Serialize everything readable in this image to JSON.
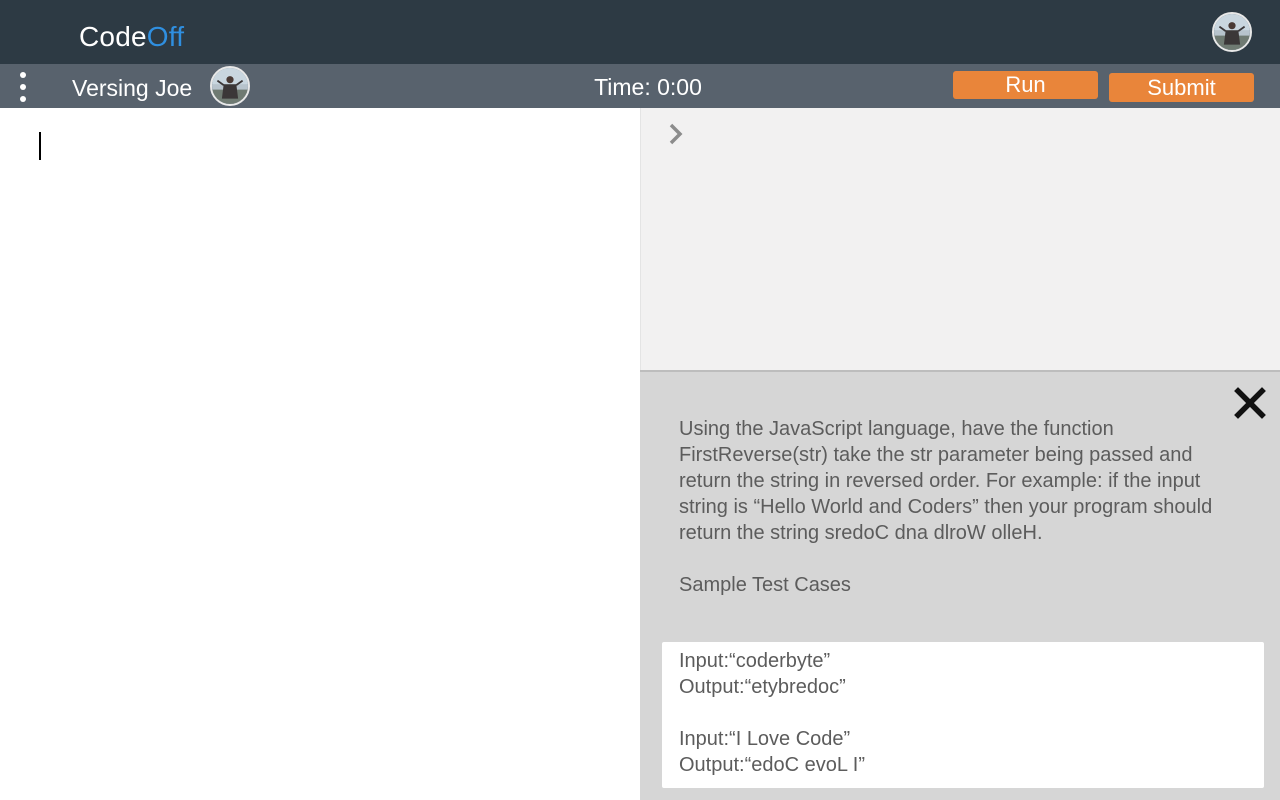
{
  "app": {
    "logo_main": "Code",
    "logo_accent": "Off",
    "accent_color": "#2f8fe0"
  },
  "header": {
    "opponent_name": "Versing Joe",
    "timer": "Time: 0:00",
    "run_label": "Run",
    "submit_label": "Submit",
    "button_color": "#e9853a"
  },
  "icons": {
    "menu": "vertical-dots-icon",
    "console_prompt": "chevron-right-icon",
    "close": "close-icon"
  },
  "problem": {
    "description": "Using the JavaScript language, have the function FirstReverse(str) take the str parameter being passed and return the string in reversed order. For example: if the input string is “Hello World and Coders” then your program should return the string sredoC dna dlroW olleH.",
    "tests_heading": "Sample Test Cases",
    "tests": [
      {
        "input": "Input:“coderbyte”",
        "output": "Output:“etybredoc”"
      },
      {
        "input": "Input:“I Love Code”",
        "output": "Output:“edoC evoL I”"
      }
    ]
  }
}
